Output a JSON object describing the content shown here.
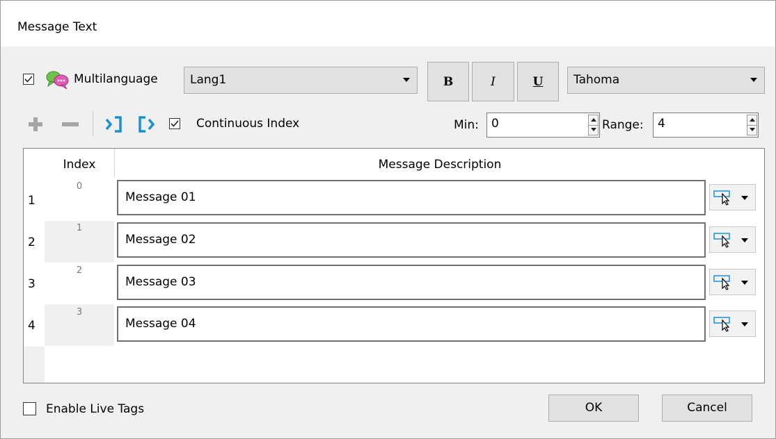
{
  "window": {
    "title": "Message Text"
  },
  "toolbar": {
    "multilanguage_checked": true,
    "multilanguage_label": "Multilanguage",
    "language_selected": "Lang1",
    "bold_label": "B",
    "italic_label": "I",
    "underline_label": "U",
    "font_selected": "Tahoma",
    "continuous_index_checked": true,
    "continuous_index_label": "Continuous Index",
    "min_label": "Min:",
    "min_value": "0",
    "range_label": "Range:",
    "range_value": "4"
  },
  "grid": {
    "index_header": "Index",
    "description_header": "Message Description",
    "rows": [
      {
        "row": "1",
        "index": "0",
        "message": "Message 01"
      },
      {
        "row": "2",
        "index": "1",
        "message": "Message 02"
      },
      {
        "row": "3",
        "index": "2",
        "message": "Message 03"
      },
      {
        "row": "4",
        "index": "3",
        "message": "Message 04"
      }
    ]
  },
  "footer": {
    "enable_live_tags_checked": false,
    "enable_live_tags_label": "Enable Live Tags",
    "ok_label": "OK",
    "cancel_label": "Cancel"
  },
  "colors": {
    "accent": "#1a8fd6",
    "icon_gray": "#a6a6a6"
  }
}
